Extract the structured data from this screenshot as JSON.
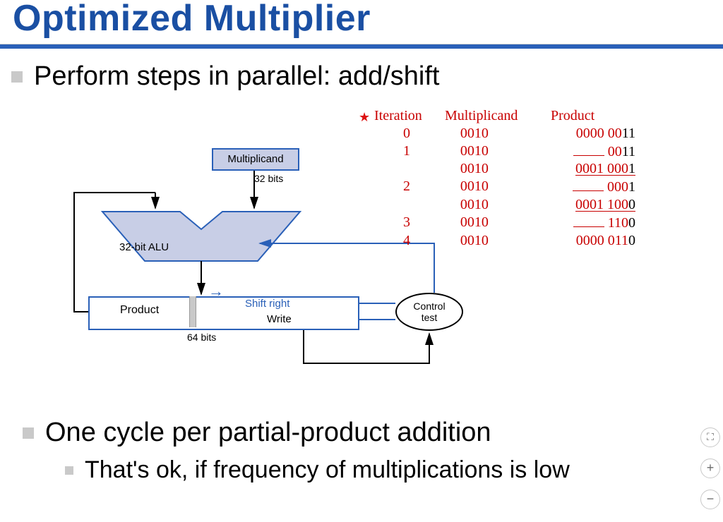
{
  "title": "Optimized Multiplier",
  "bullets": {
    "b1": "Perform steps in parallel: add/shift",
    "b2": "One cycle per partial-product addition",
    "b2a": "That's ok, if frequency of multiplications is low"
  },
  "diagram": {
    "multiplicand": "Multiplicand",
    "mcand_bits": "32 bits",
    "alu": "32-bit ALU",
    "product": "Product",
    "shift_right": "Shift right",
    "write": "Write",
    "control1": "Control",
    "control2": "test",
    "prod_bits": "64 bits"
  },
  "table": {
    "star": "★",
    "headers": {
      "iter": "Iteration",
      "mcand": "Multiplicand",
      "prod": "Product"
    },
    "rows": [
      {
        "iter": "0",
        "mcand": "0010",
        "prod_red": "0000 00",
        "prod_black": "11",
        "underline": false,
        "uspace": false
      },
      {
        "iter": "1",
        "mcand": "0010",
        "prod_red": "00",
        "prod_black": "11",
        "underline": false,
        "uspace": true
      },
      {
        "iter": "",
        "mcand": "0010",
        "prod_red": "0001 000",
        "prod_black": "1",
        "underline": true,
        "uspace": false
      },
      {
        "iter": "2",
        "mcand": "0010",
        "prod_red": "000",
        "prod_black": "1",
        "underline": false,
        "uspace": true
      },
      {
        "iter": "",
        "mcand": "0010",
        "prod_red": "0001 100",
        "prod_black": "0",
        "underline": true,
        "uspace": false
      },
      {
        "iter": "3",
        "mcand": "0010",
        "prod_red": "110",
        "prod_black": "0",
        "underline": false,
        "uspace": true
      },
      {
        "iter": "4",
        "mcand": "0010",
        "prod_red": "0000 011",
        "prod_black": "0",
        "underline": false,
        "uspace": false
      }
    ]
  },
  "controls": {
    "expand": "⛶",
    "plus": "+",
    "minus": "−"
  }
}
